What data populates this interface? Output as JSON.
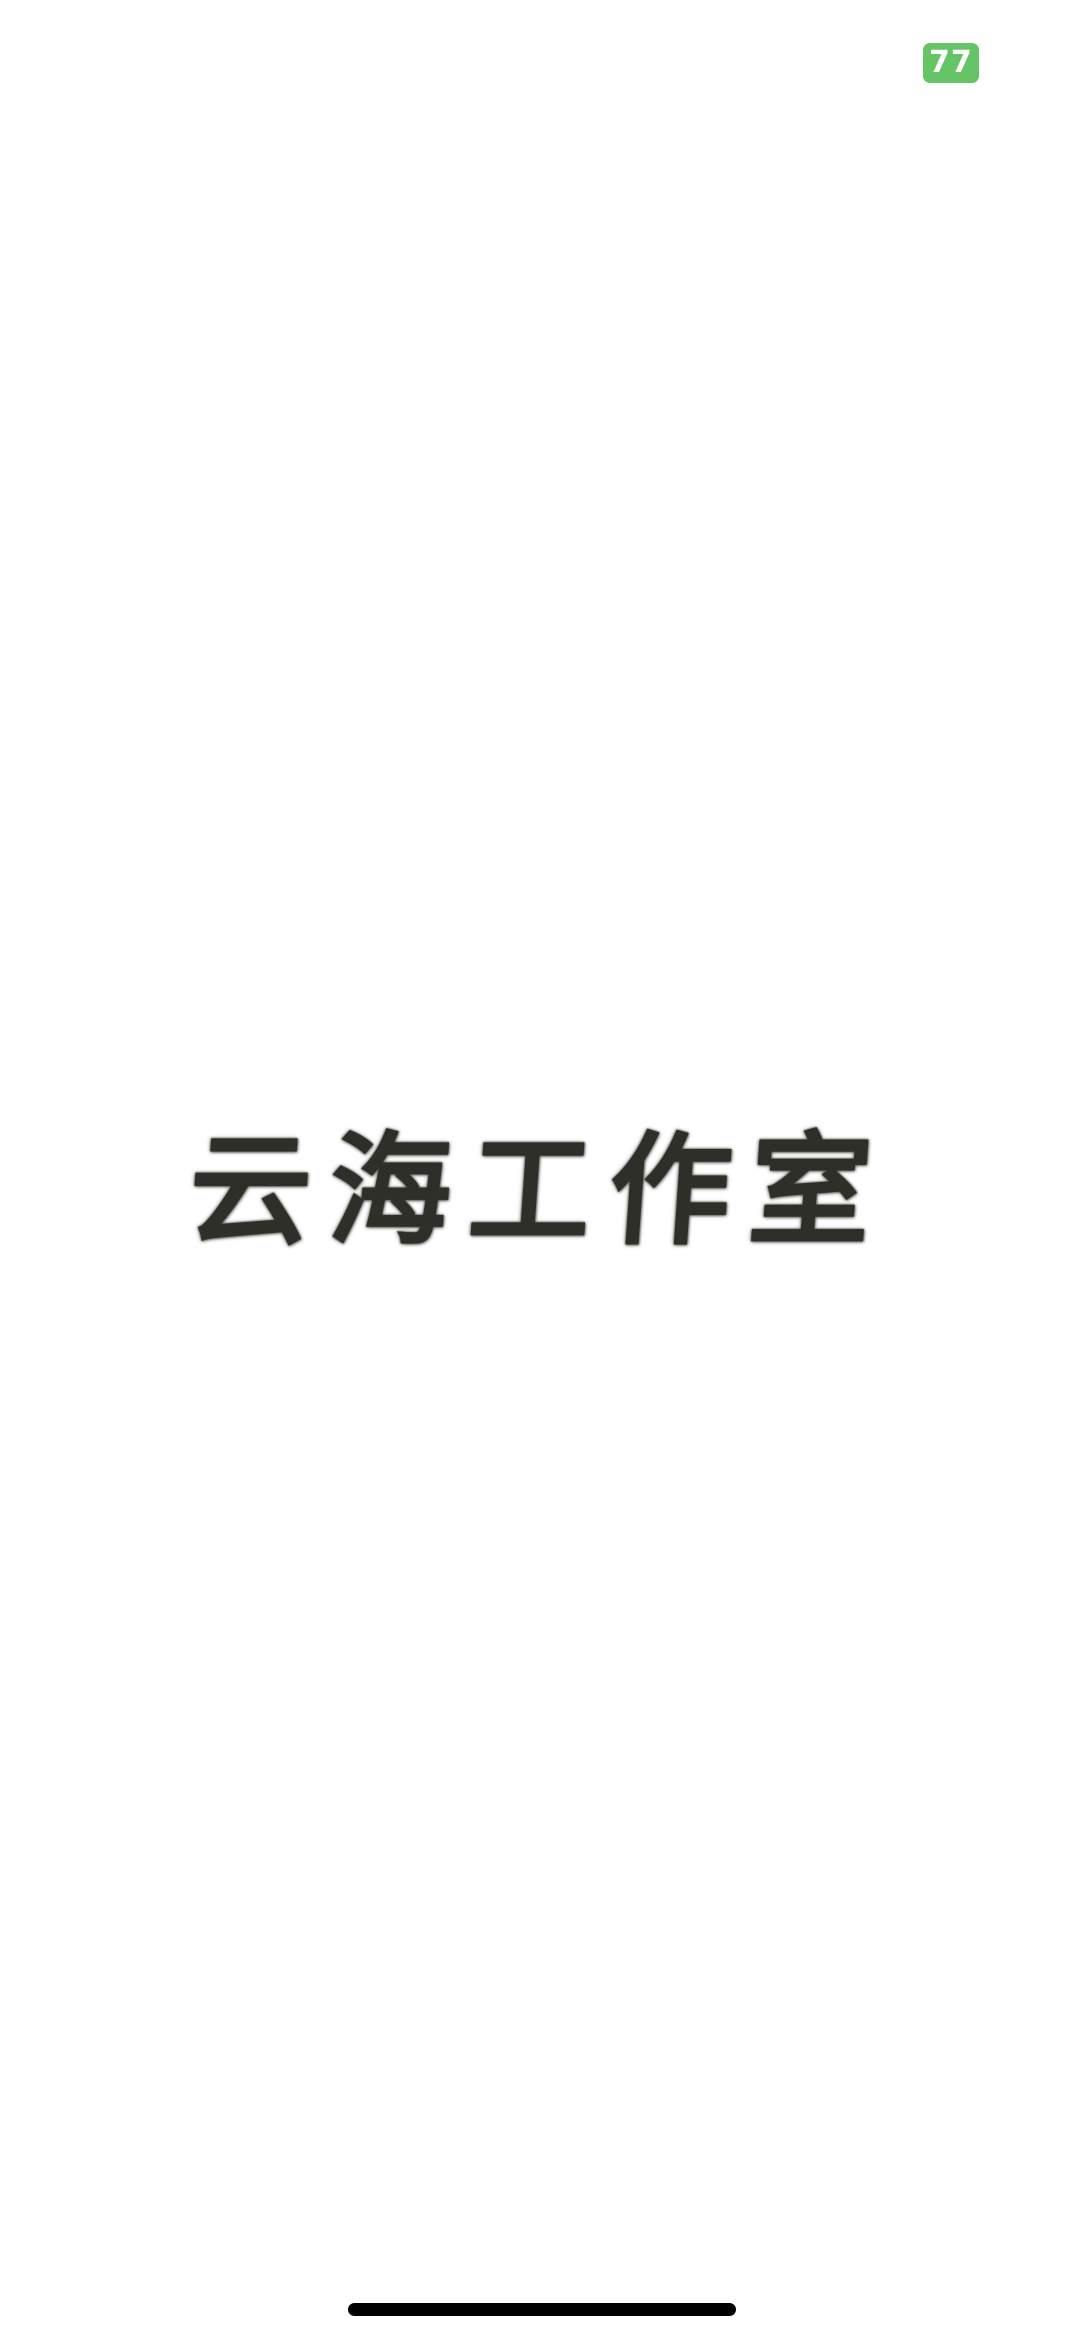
{
  "status_bar": {
    "battery_level": "77",
    "battery_color": "#65c466"
  },
  "splash": {
    "brand_name": "云海工作室"
  },
  "colors": {
    "background": "#ffffff",
    "logo_ink": "#2f2f2a",
    "home_indicator": "#000000"
  }
}
